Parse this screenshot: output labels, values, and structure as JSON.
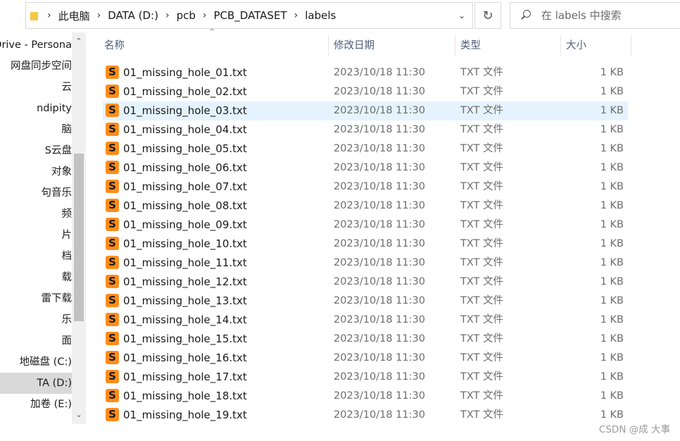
{
  "address_bar": {
    "breadcrumbs": [
      "此电脑",
      "DATA (D:)",
      "pcb",
      "PCB_DATASET",
      "labels"
    ]
  },
  "search": {
    "placeholder": "在 labels 中搜索"
  },
  "nav_pane": {
    "items": [
      {
        "label": "Drive - Persona",
        "selected": false
      },
      {
        "label": "网盘同步空间",
        "selected": false
      },
      {
        "label": "云",
        "selected": false
      },
      {
        "label": "ndipity",
        "selected": false
      },
      {
        "label": "脑",
        "selected": false
      },
      {
        "label": "S云盘",
        "selected": false
      },
      {
        "label": "对象",
        "selected": false
      },
      {
        "label": "句音乐",
        "selected": false
      },
      {
        "label": "频",
        "selected": false
      },
      {
        "label": "片",
        "selected": false
      },
      {
        "label": "档",
        "selected": false
      },
      {
        "label": "载",
        "selected": false
      },
      {
        "label": "雷下载",
        "selected": false
      },
      {
        "label": "乐",
        "selected": false
      },
      {
        "label": "面",
        "selected": false
      },
      {
        "label": "地磁盘 (C:)",
        "selected": false
      },
      {
        "label": "TA (D:)",
        "selected": true
      },
      {
        "label": "加卷 (E:)",
        "selected": false
      }
    ]
  },
  "columns": {
    "name": "名称",
    "modified": "修改日期",
    "type": "类型",
    "size": "大小"
  },
  "files": [
    {
      "name": "01_missing_hole_01.txt",
      "modified": "2023/10/18 11:30",
      "type": "TXT 文件",
      "size": "1 KB"
    },
    {
      "name": "01_missing_hole_02.txt",
      "modified": "2023/10/18 11:30",
      "type": "TXT 文件",
      "size": "1 KB"
    },
    {
      "name": "01_missing_hole_03.txt",
      "modified": "2023/10/18 11:30",
      "type": "TXT 文件",
      "size": "1 KB"
    },
    {
      "name": "01_missing_hole_04.txt",
      "modified": "2023/10/18 11:30",
      "type": "TXT 文件",
      "size": "1 KB"
    },
    {
      "name": "01_missing_hole_05.txt",
      "modified": "2023/10/18 11:30",
      "type": "TXT 文件",
      "size": "1 KB"
    },
    {
      "name": "01_missing_hole_06.txt",
      "modified": "2023/10/18 11:30",
      "type": "TXT 文件",
      "size": "1 KB"
    },
    {
      "name": "01_missing_hole_07.txt",
      "modified": "2023/10/18 11:30",
      "type": "TXT 文件",
      "size": "1 KB"
    },
    {
      "name": "01_missing_hole_08.txt",
      "modified": "2023/10/18 11:30",
      "type": "TXT 文件",
      "size": "1 KB"
    },
    {
      "name": "01_missing_hole_09.txt",
      "modified": "2023/10/18 11:30",
      "type": "TXT 文件",
      "size": "1 KB"
    },
    {
      "name": "01_missing_hole_10.txt",
      "modified": "2023/10/18 11:30",
      "type": "TXT 文件",
      "size": "1 KB"
    },
    {
      "name": "01_missing_hole_11.txt",
      "modified": "2023/10/18 11:30",
      "type": "TXT 文件",
      "size": "1 KB"
    },
    {
      "name": "01_missing_hole_12.txt",
      "modified": "2023/10/18 11:30",
      "type": "TXT 文件",
      "size": "1 KB"
    },
    {
      "name": "01_missing_hole_13.txt",
      "modified": "2023/10/18 11:30",
      "type": "TXT 文件",
      "size": "1 KB"
    },
    {
      "name": "01_missing_hole_14.txt",
      "modified": "2023/10/18 11:30",
      "type": "TXT 文件",
      "size": "1 KB"
    },
    {
      "name": "01_missing_hole_15.txt",
      "modified": "2023/10/18 11:30",
      "type": "TXT 文件",
      "size": "1 KB"
    },
    {
      "name": "01_missing_hole_16.txt",
      "modified": "2023/10/18 11:30",
      "type": "TXT 文件",
      "size": "1 KB"
    },
    {
      "name": "01_missing_hole_17.txt",
      "modified": "2023/10/18 11:30",
      "type": "TXT 文件",
      "size": "1 KB"
    },
    {
      "name": "01_missing_hole_18.txt",
      "modified": "2023/10/18 11:30",
      "type": "TXT 文件",
      "size": "1 KB"
    },
    {
      "name": "01_missing_hole_19.txt",
      "modified": "2023/10/18 11:30",
      "type": "TXT 文件",
      "size": "1 KB"
    }
  ],
  "hover_row_index": 2,
  "watermark": "CSDN @成 大事",
  "colors": {
    "hover_row": "#e5f3ff",
    "nav_selected": "#d9d9d9",
    "file_icon": "#ff8c1a",
    "header_text": "#4c607a"
  },
  "icons": {
    "folder": "folder-icon",
    "refresh": "refresh-icon",
    "search": "search-icon",
    "file": "sublime-text-file-icon",
    "dropdown": "chevron-down-icon"
  }
}
